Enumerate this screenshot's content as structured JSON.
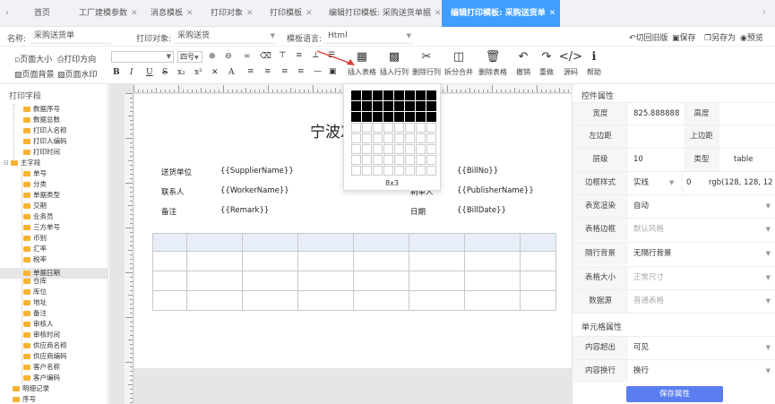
{
  "tabs": [
    {
      "label": "首页",
      "closable": false
    },
    {
      "label": "工厂建模参数",
      "closable": true
    },
    {
      "label": "消息模板",
      "closable": true
    },
    {
      "label": "打印对象",
      "closable": true
    },
    {
      "label": "打印模板",
      "closable": true
    },
    {
      "label": "编辑打印模板: 采购送货单据",
      "closable": true
    },
    {
      "label": "编辑打印模板: 采购送货单",
      "closable": true
    }
  ],
  "info": {
    "name_label": "名称:",
    "name_value": "采购送货单",
    "object_label": "打印对象:",
    "object_value": "采购送货",
    "lang_label": "模板语言:",
    "lang_value": "Html",
    "actions": [
      "切回旧版",
      "保存",
      "另存为",
      "预览"
    ]
  },
  "toolbar": {
    "page_size": "页面大小",
    "page_dir": "打印方向",
    "page_bg": "页面背景",
    "page_wm": "页面水印",
    "font_size": "四号",
    "buttons": [
      "插入表格",
      "插入行列",
      "删除行列",
      "拆分合并",
      "删除表格",
      "撤销",
      "重做",
      "源码",
      "帮助"
    ]
  },
  "left": {
    "title": "打印字段",
    "group1": [
      "数据序号",
      "数据总数",
      "打印人名称",
      "打印人编码",
      "打印时间"
    ],
    "main_group": "主字段",
    "main_items": [
      "单号",
      "分类",
      "单据类型",
      "交期",
      "业务员",
      "三方单号",
      "币别",
      "汇率",
      "税率",
      "单据日期",
      "仓库",
      "库位",
      "地址",
      "备注",
      "审核人",
      "审核时间",
      "供应商名称",
      "供应商编码",
      "客户名称",
      "客户编码"
    ],
    "selected": "单据日期",
    "tail": [
      "明细记录",
      "序号"
    ]
  },
  "canvas": {
    "title": "宁波X",
    "fields": [
      {
        "label": "送货单位",
        "value": "{{SupplierName}}"
      },
      {
        "label": "联系人",
        "value": "{{WorkerName}}"
      },
      {
        "label": "备注",
        "value": "{{Remark}}"
      }
    ],
    "right_fields": [
      {
        "label": "",
        "value": "{{BillNo}}"
      },
      {
        "label": "制单人",
        "value": "{{PublisherName}}"
      },
      {
        "label": "日期",
        "value": "{{BillDate}}"
      }
    ]
  },
  "popup": {
    "rows_selected": 3,
    "cols_selected": 8,
    "label": "8x3"
  },
  "props": {
    "section_title": "控件属性",
    "width_label": "宽度",
    "width_value": "825.888888",
    "height_label": "高度",
    "left_margin_label": "左边距",
    "top_margin_label": "上边距",
    "z_label": "层级",
    "z_value": "10",
    "type_label": "类型",
    "type_value": "table",
    "border_label": "边框样式",
    "border_style": "实线",
    "border_width": "0",
    "border_color": "rgb(128, 128, 12",
    "render_label": "表宽渲染",
    "render_value": "自动",
    "tborder_label": "表格边框",
    "tborder_value": "默认风格",
    "rowbg_label": "隔行背景",
    "rowbg_value": "无隔行背景",
    "tsize_label": "表格大小",
    "tsize_value": "正常尺寸",
    "ds_label": "数据源",
    "ds_value": "普通表格",
    "cell_section": "单元格属性",
    "overflow_label": "内容超出",
    "overflow_value": "可见",
    "wrap_label": "内容换行",
    "wrap_value": "换行",
    "save_label": "保存属性"
  },
  "colors": {
    "accent": "#409eff",
    "save_button": "#5a7ef0",
    "folder": "#f5b335"
  }
}
